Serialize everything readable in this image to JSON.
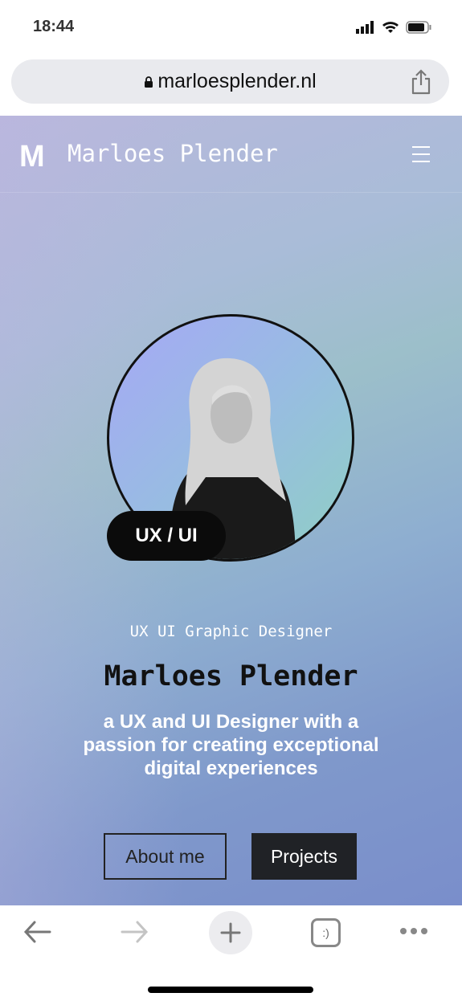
{
  "status_bar": {
    "time": "18:44",
    "icons": [
      "signal-icon",
      "wifi-icon",
      "battery-icon"
    ]
  },
  "browser": {
    "url": "marloesplender.nl",
    "lock_icon": "lock-icon",
    "share_icon": "share-icon"
  },
  "site": {
    "logo": "M",
    "brand": "Marloes Plender",
    "menu_icon": "hamburger-icon",
    "hero": {
      "badge": "UX / UI",
      "role": "UX UI Graphic Designer",
      "name": "Marloes Plender",
      "tagline": "a UX and UI Designer with a passion for creating exceptional digital experiences",
      "buttons": {
        "about": "About me",
        "projects": "Projects"
      }
    }
  },
  "toolbar": {
    "items": [
      "back-icon",
      "forward-icon",
      "new-tab-icon",
      "tabs-icon",
      "more-icon"
    ],
    "tabs_label": ":)"
  }
}
